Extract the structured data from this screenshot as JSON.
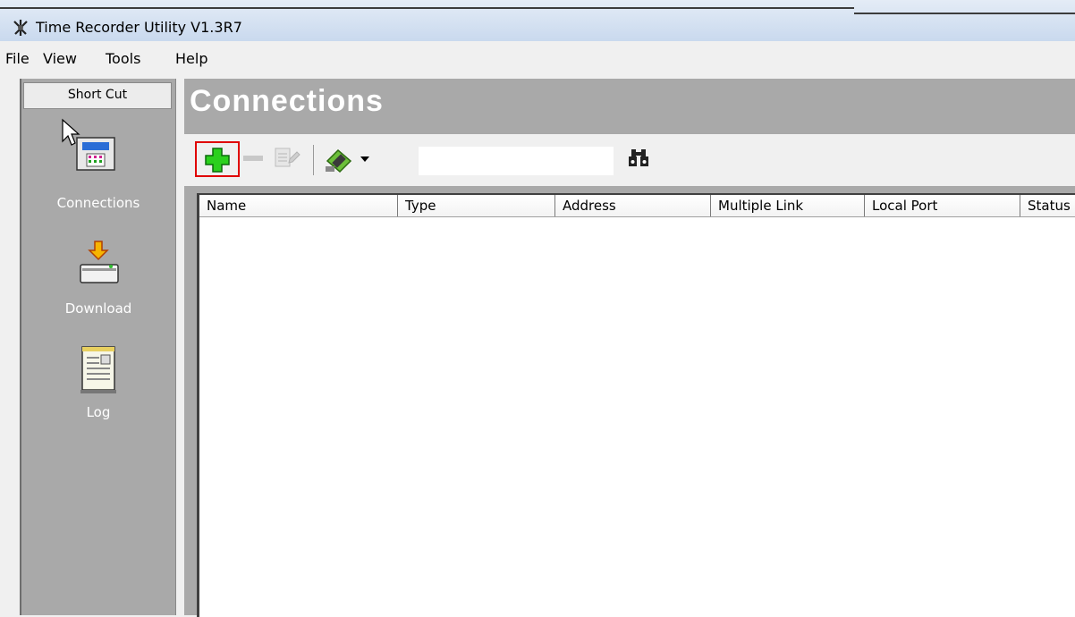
{
  "window": {
    "title": "Time Recorder Utility V1.3R7"
  },
  "menu": [
    "File",
    "View",
    "Tools",
    "Help"
  ],
  "shortcut": {
    "header": "Short Cut",
    "items": [
      {
        "label": "Connections",
        "icon": "time-recorder-icon"
      },
      {
        "label": "Download",
        "icon": "download-icon"
      },
      {
        "label": "Log",
        "icon": "log-icon"
      }
    ]
  },
  "main": {
    "title": "Connections",
    "toolbar": {
      "buttons": [
        "add-icon",
        "remove-icon",
        "edit-icon",
        "connect-icon",
        "dropdown-arrow-icon",
        "binoculars-icon"
      ],
      "search": {
        "value": "",
        "placeholder": ""
      }
    },
    "table": {
      "columns": [
        "Name",
        "Type",
        "Address",
        "Multiple Link",
        "Local Port",
        "Status"
      ],
      "rows": []
    }
  },
  "colors": {
    "panel": "#a9a9a9",
    "add": "#2bd01d",
    "highlight": "#e00000"
  }
}
